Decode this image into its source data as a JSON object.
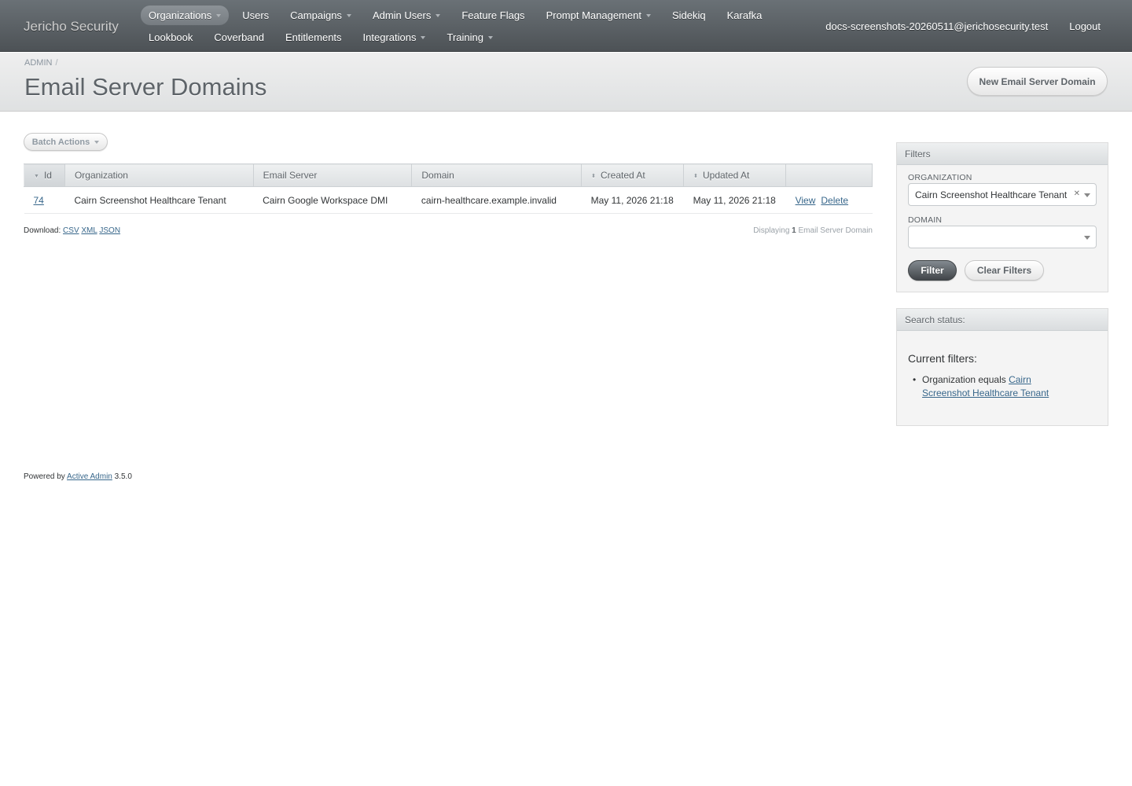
{
  "header": {
    "site_title": "Jericho Security",
    "nav_row1": [
      {
        "label": "Organizations",
        "dropdown": true,
        "current": true
      },
      {
        "label": "Users",
        "dropdown": false
      },
      {
        "label": "Campaigns",
        "dropdown": true
      },
      {
        "label": "Admin Users",
        "dropdown": true
      },
      {
        "label": "Feature Flags",
        "dropdown": false
      },
      {
        "label": "Prompt Management",
        "dropdown": true
      },
      {
        "label": "Sidekiq",
        "dropdown": false
      },
      {
        "label": "Karafka",
        "dropdown": false
      }
    ],
    "nav_row2": [
      {
        "label": "Lookbook",
        "dropdown": false
      },
      {
        "label": "Coverband",
        "dropdown": false
      },
      {
        "label": "Entitlements",
        "dropdown": false
      },
      {
        "label": "Integrations",
        "dropdown": true
      },
      {
        "label": "Training",
        "dropdown": true
      }
    ],
    "user_email": "docs-screenshots-20260511@jerichosecurity.test",
    "logout_label": "Logout"
  },
  "title_bar": {
    "breadcrumb": "ADMIN",
    "breadcrumb_sep": "/",
    "page_title": "Email Server Domains",
    "new_button": "New Email Server Domain"
  },
  "main": {
    "batch_actions_label": "Batch Actions",
    "columns": [
      "Id",
      "Organization",
      "Email Server",
      "Domain",
      "Created At",
      "Updated At",
      ""
    ],
    "rows": [
      {
        "id": "74",
        "organization": "Cairn Screenshot Healthcare Tenant",
        "email_server": "Cairn Google Workspace DMI",
        "domain": "cairn-healthcare.example.invalid",
        "created_at": "May 11, 2026 21:18",
        "updated_at": "May 11, 2026 21:18",
        "view_label": "View",
        "delete_label": "Delete"
      }
    ],
    "download_label": "Download:",
    "download_formats": [
      "CSV",
      "XML",
      "JSON"
    ],
    "pagination_prefix": "Displaying",
    "pagination_count": "1",
    "pagination_suffix": "Email Server Domain"
  },
  "sidebar": {
    "filters_title": "Filters",
    "organization_label": "ORGANIZATION",
    "organization_value": "Cairn Screenshot Healthcare Tenant",
    "domain_label": "DOMAIN",
    "domain_value": "",
    "filter_button": "Filter",
    "clear_button": "Clear Filters",
    "status_title": "Search status:",
    "current_filters_label": "Current filters:",
    "filter_entry_prefix": "Organization equals",
    "filter_entry_link": "Cairn Screenshot Healthcare Tenant"
  },
  "footer": {
    "powered_by": "Powered by",
    "link": "Active Admin",
    "version": "3.5.0"
  }
}
